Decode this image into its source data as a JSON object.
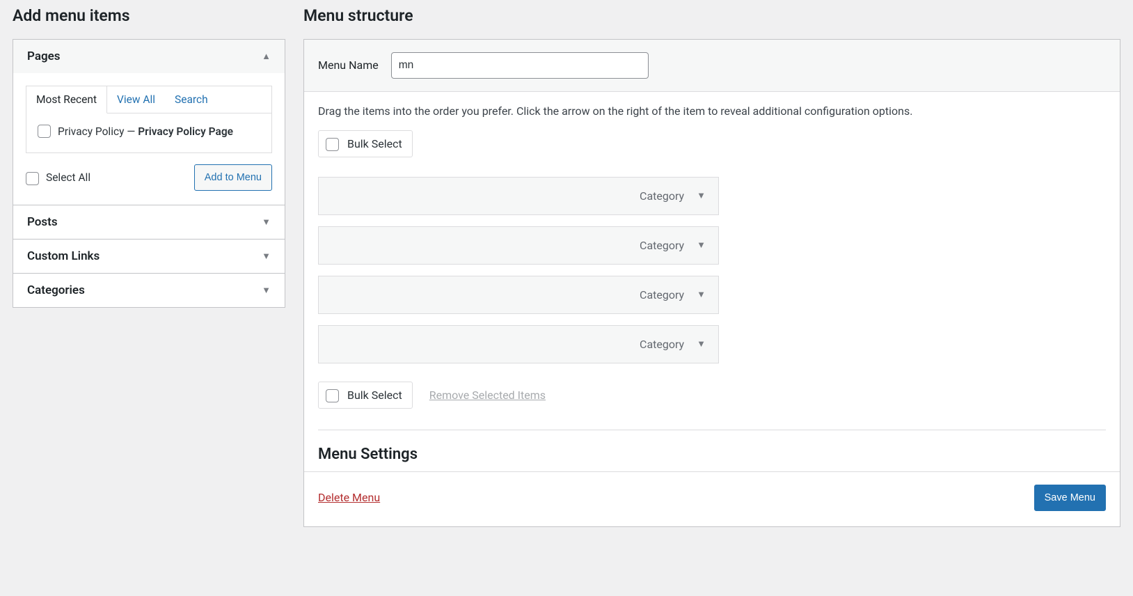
{
  "left": {
    "heading": "Add menu items",
    "accordion": [
      {
        "title": "Pages",
        "open": true,
        "tabs": [
          "Most Recent",
          "View All",
          "Search"
        ],
        "active_tab": 0,
        "page_item": {
          "pre": "Privacy Policy — ",
          "bold": "Privacy Policy Page"
        },
        "select_all": "Select All",
        "add_button": "Add to Menu"
      },
      {
        "title": "Posts",
        "open": false
      },
      {
        "title": "Custom Links",
        "open": false
      },
      {
        "title": "Categories",
        "open": false
      }
    ]
  },
  "right": {
    "heading": "Menu structure",
    "menu_name_label": "Menu Name",
    "menu_name_value": "mn",
    "instructions": "Drag the items into the order you prefer. Click the arrow on the right of the item to reveal additional configuration options.",
    "bulk_select": "Bulk Select",
    "items": [
      {
        "title": "",
        "type": "Category"
      },
      {
        "title": "",
        "type": "Category"
      },
      {
        "title": "",
        "type": "Category"
      },
      {
        "title": "",
        "type": "Category"
      }
    ],
    "remove_selected": "Remove Selected Items",
    "menu_settings": "Menu Settings",
    "delete_menu": "Delete Menu",
    "save_menu": "Save Menu"
  }
}
